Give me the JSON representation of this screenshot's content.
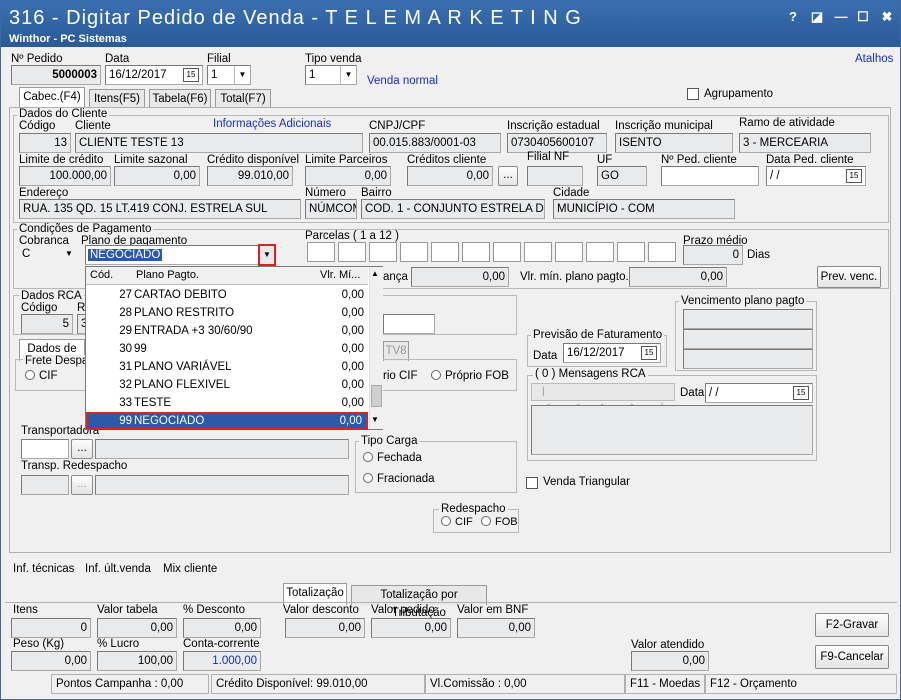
{
  "window": {
    "title": "316 - Digitar Pedido de Venda - T E L E M A R K E T I N G",
    "subtitle": "Winthor - PC Sistemas",
    "btn_help": "?",
    "btn_max": "◪",
    "btn_min": "—",
    "btn_restore": "☐",
    "btn_close": "✖"
  },
  "header": {
    "pedido_label": "Nº Pedido",
    "pedido": "5000003",
    "data_label": "Data",
    "data": "16/12/2017",
    "filial_label": "Filial",
    "filial": "1",
    "tipo_label": "Tipo venda",
    "tipo": "1",
    "tipo_desc": "Venda normal",
    "atalhos": "Atalhos",
    "agrupamento": "Agrupamento"
  },
  "tabs": {
    "cabec": "Cabec.(F4)",
    "itens": "Itens(F5)",
    "tabela": "Tabela(F6)",
    "total": "Total(F7)"
  },
  "cliente": {
    "group": "Dados do Cliente",
    "codigo_label": "Código",
    "codigo": "13",
    "cliente_label": "Cliente",
    "cliente": "CLIENTE TESTE 13",
    "info_link": "Informações Adicionais",
    "cnpj_label": "CNPJ/CPF",
    "cnpj": "00.015.883/0001-03",
    "ie_label": "Inscrição estadual",
    "ie": "0730405600107",
    "im_label": "Inscrição municipal",
    "im": "ISENTO",
    "ramo_label": "Ramo de atividade",
    "ramo": "3 - MERCEARIA",
    "limite_label": "Limite de crédito",
    "limite": "100.000,00",
    "sazonal_label": "Limite sazonal",
    "sazonal": "0,00",
    "credito_label": "Crédito disponível",
    "credito": "99.010,00",
    "parceiros_label": "Limite Parceiros",
    "parceiros": "0,00",
    "creditos_label": "Créditos cliente",
    "creditos": "0,00",
    "filialnf_label": "Filial NF",
    "uf_label": "UF",
    "uf": "GO",
    "noped_label": "Nº Ped. cliente",
    "dataped_label": "Data Ped. cliente",
    "dataped": " / /",
    "endereco_label": "Endereço",
    "endereco": "RUA. 135 QD. 15 LT.419 CONJ. ESTRELA SUL",
    "numero_label": "Número",
    "numero": "NÚMCOM",
    "bairro_label": "Bairro",
    "bairro": "COD. 1 - CONJUNTO ESTRELA DO SU",
    "cidade_label": "Cidade",
    "cidade": "MUNICÍPIO - COM"
  },
  "pagamento": {
    "group": "Condições de Pagamento",
    "cobranca_label": "Cobranca",
    "cobranca": "C",
    "plano_label": "Plano de pagamento",
    "plano": "NEGOCIADO",
    "parcelas_label": "Parcelas ( 1 a 12 )",
    "prazo_label": "Prazo médio",
    "prazo": "0",
    "dias": "Dias",
    "anca": "ança",
    "anca_val": "0,00",
    "vlrmin_label": "Vlr. mín. plano pagto.",
    "vlrmin": "0,00",
    "prev_venc": "Prev. venc."
  },
  "dropdown": {
    "h_cod": "Cód.",
    "h_plano": "Plano Pagto.",
    "h_vlr": "Vlr. Mí...",
    "rows": [
      {
        "cod": "27",
        "plano": "CARTAO DEBITO",
        "vlr": "0,00"
      },
      {
        "cod": "28",
        "plano": "PLANO RESTRITO",
        "vlr": "0,00"
      },
      {
        "cod": "29",
        "plano": "ENTRADA +3 30/60/90",
        "vlr": "0,00"
      },
      {
        "cod": "30",
        "plano": "99",
        "vlr": "0,00"
      },
      {
        "cod": "31",
        "plano": "PLANO VARIÁVEL",
        "vlr": "0,00"
      },
      {
        "cod": "32",
        "plano": "PLANO FLEXIVEL",
        "vlr": "0,00"
      },
      {
        "cod": "33",
        "plano": "TESTE",
        "vlr": "0,00"
      },
      {
        "cod": "99",
        "plano": "NEGOCIADO",
        "vlr": "0,00"
      }
    ]
  },
  "rca": {
    "group": "Dados RCA",
    "codigo_label": "Código",
    "r": "R",
    "codigo": "5",
    "three": "3",
    "dados": "Dados de",
    "tv8": "TV8",
    "frete": "Frete Despac",
    "cif": "CIF",
    "proprio_cif": "rio CIF",
    "proprio_fob": "Próprio FOB"
  },
  "previsao": {
    "group": "Previsão de Faturamento",
    "data_label": "Data",
    "data": "16/12/2017"
  },
  "vencimento": {
    "group": "Vencimento plano pagto"
  },
  "mensagens": {
    "group": "( 0 ) Mensagens RCA",
    "data_label": "Data",
    "data": " / /"
  },
  "transp": {
    "label": "Transportadora",
    "redespacho_label": "Transp. Redespacho",
    "tipo_carga": "Tipo Carga",
    "fechada": "Fechada",
    "fracionada": "Fracionada",
    "venda_triangular": "Venda Triangular",
    "redespacho": "Redespacho",
    "r_cif": "CIF",
    "r_fob": "FOB",
    "ellipsis": "..."
  },
  "links": {
    "inf_tecnicas": "Inf. técnicas",
    "inf_ult": "Inf. últ.venda",
    "mix": "Mix cliente"
  },
  "totais": {
    "tab1": "Totalização",
    "tab2": "Totalização por Tributação",
    "itens_label": "Itens",
    "itens": "0",
    "valor_tabela_label": "Valor tabela",
    "valor_tabela": "0,00",
    "desconto_label": "% Desconto",
    "desconto": "0,00",
    "valor_desconto_label": "Valor desconto",
    "valor_desconto": "0,00",
    "valor_pedido_label": "Valor pedido",
    "valor_pedido": "0,00",
    "bnf_label": "Valor em BNF",
    "bnf": "0,00",
    "peso_label": "Peso (Kg)",
    "peso": "0,00",
    "lucro_label": "% Lucro",
    "lucro": "100,00",
    "conta_label": "Conta-corrente",
    "conta": "1.000,00",
    "atendido_label": "Valor atendido",
    "atendido": "0,00",
    "gravar": "F2-Gravar",
    "cancelar": "F9-Cancelar"
  },
  "status": {
    "pontos": "Pontos Campanha : 0,00",
    "credito": "Crédito Disponível: 99.010,00",
    "comissao": "Vl.Comissão : 0,00",
    "f11": "F11 - Moedas",
    "f12": "F12 - Orçamento"
  },
  "colors": {
    "title_bg": "#2a5a98",
    "link": "#1a2fbf",
    "selection": "#2a5aa8",
    "highlight_box": "#e02020"
  }
}
